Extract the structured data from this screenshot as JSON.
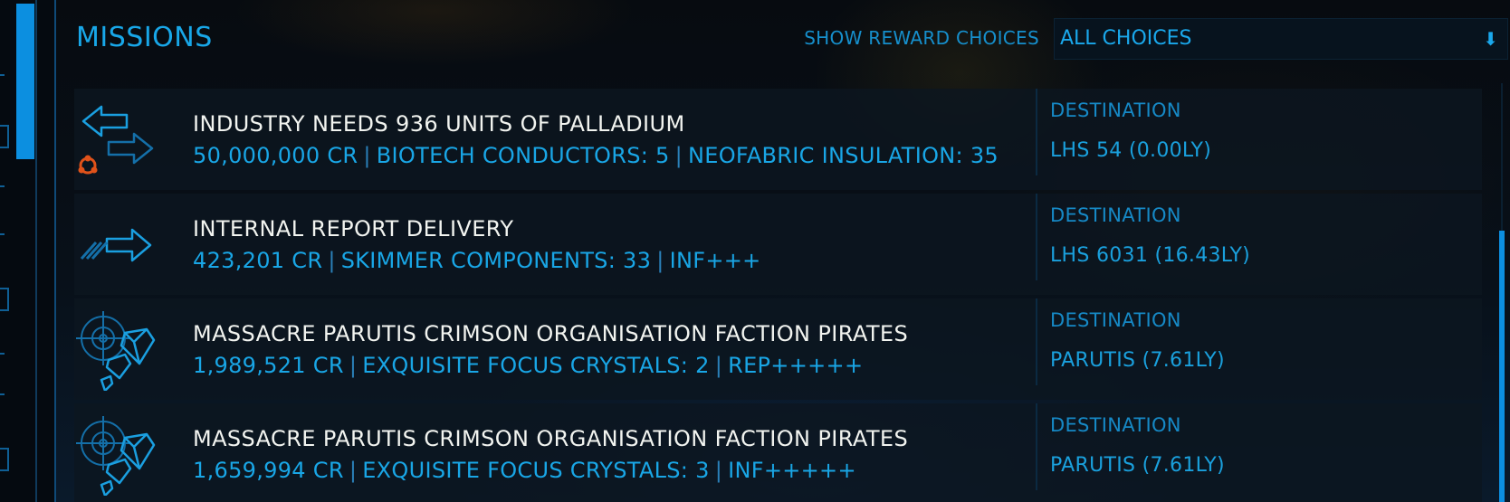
{
  "header": {
    "title": "MISSIONS",
    "filter_label": "SHOW REWARD CHOICES",
    "filter_value": "ALL CHOICES"
  },
  "destination_label": "DESTINATION",
  "missions": [
    {
      "icon": "trade-arrows-icon",
      "badge_icon": "faction-badge-icon",
      "title": "INDUSTRY NEEDS 936 UNITS OF PALLADIUM",
      "rewards": [
        "50,000,000 CR",
        "BIOTECH CONDUCTORS: 5",
        "NEOFABRIC INSULATION: 35"
      ],
      "destination": "LHS 54 (0.00LY)"
    },
    {
      "icon": "courier-arrow-icon",
      "title": "INTERNAL REPORT DELIVERY",
      "rewards": [
        "423,201 CR",
        "SKIMMER COMPONENTS: 33",
        "INF+++"
      ],
      "destination": "LHS 6031 (16.43LY)"
    },
    {
      "icon": "massacre-crystals-icon",
      "title": "MASSACRE PARUTIS CRIMSON ORGANISATION FACTION PIRATES",
      "rewards": [
        "1,989,521 CR",
        "EXQUISITE FOCUS CRYSTALS: 2",
        "REP+++++"
      ],
      "destination": "PARUTIS (7.61LY)"
    },
    {
      "icon": "massacre-crystals-icon",
      "title": "MASSACRE PARUTIS CRIMSON ORGANISATION FACTION PIRATES",
      "rewards": [
        "1,659,994 CR",
        "EXQUISITE FOCUS CRYSTALS: 3",
        "INF+++++"
      ],
      "destination": "PARUTIS (7.61LY)"
    }
  ],
  "colors": {
    "accent": "#18a7e8",
    "title_text": "#f2f4f0",
    "badge": "#e0521a"
  }
}
